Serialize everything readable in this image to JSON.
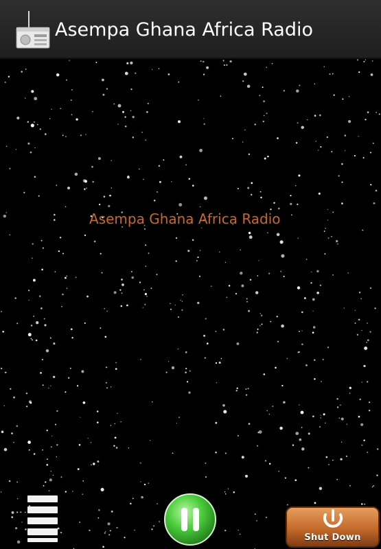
{
  "action_bar": {
    "title": "Asempa Ghana Africa Radio",
    "icon": "radio-icon"
  },
  "main": {
    "station_label": "Asempa Ghana Africa Radio",
    "background": "starfield"
  },
  "controls": {
    "menu_icon": "hamburger-menu-icon",
    "pause_icon": "pause-icon",
    "shutdown_label": "Shut Down",
    "shutdown_icon": "power-icon"
  },
  "colors": {
    "action_bar_bg": "#2a2a2a",
    "station_label": "#c8682a",
    "pause_button_green": "#3fc03a",
    "shutdown_orange": "#c46a2a"
  }
}
